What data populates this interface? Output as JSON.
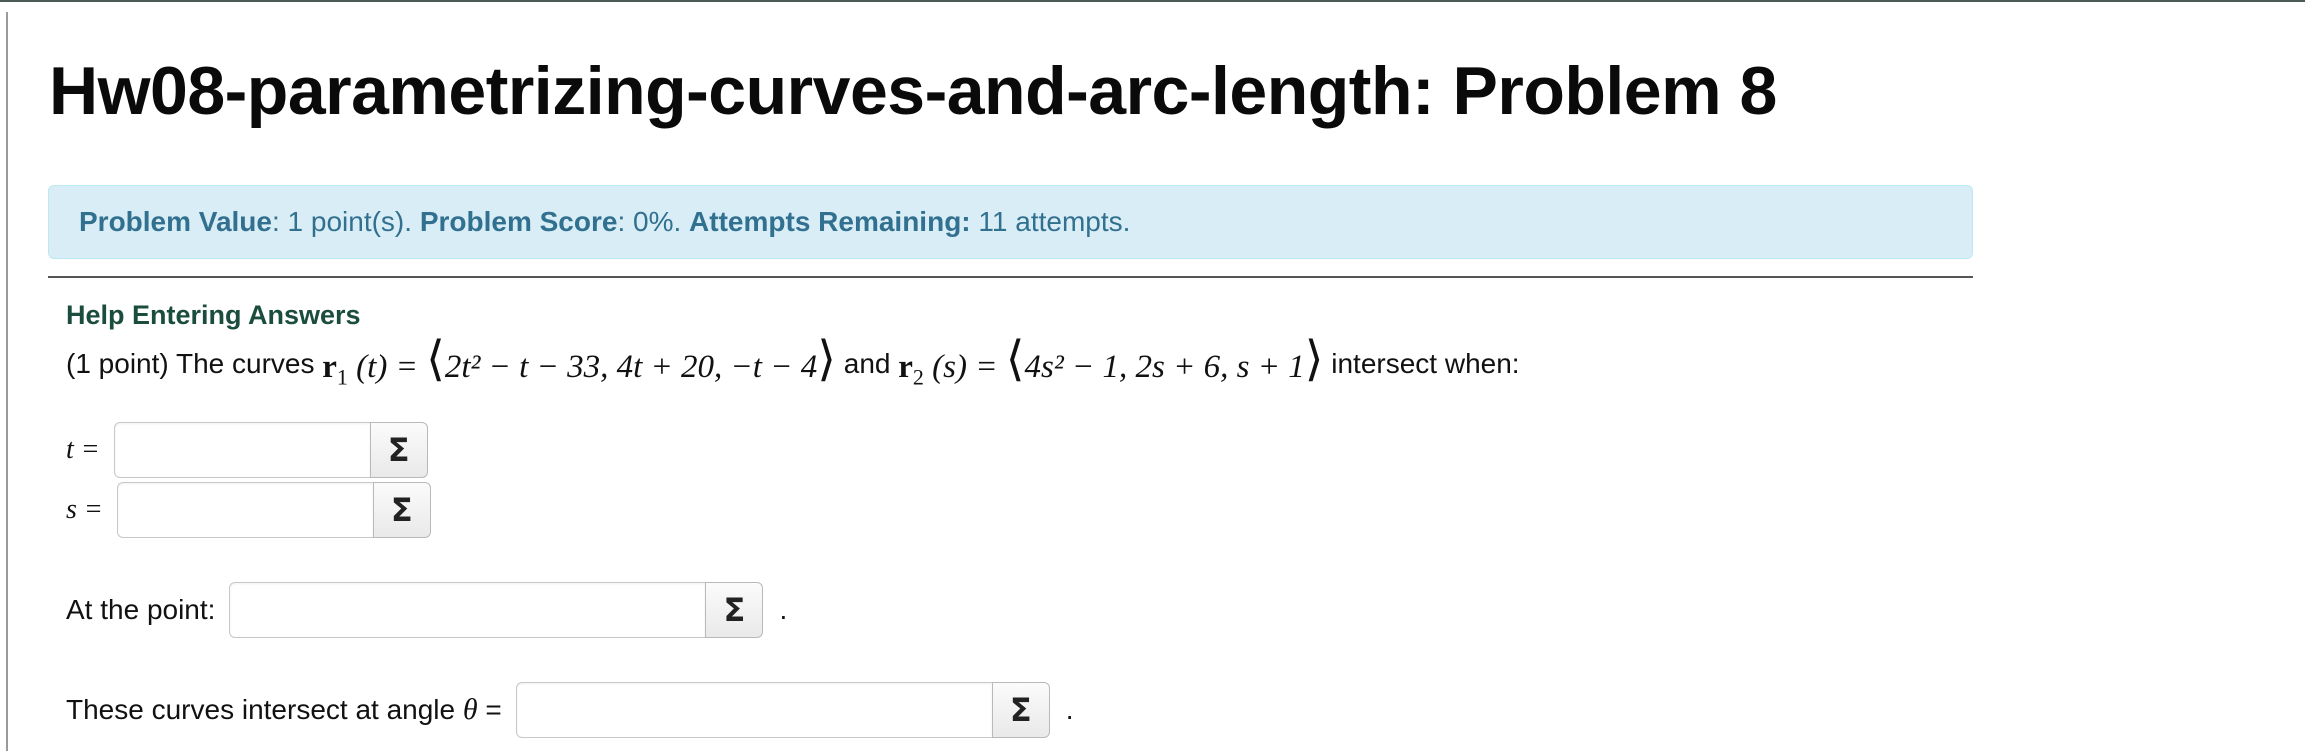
{
  "page": {
    "title": "Hw08-parametrizing-curves-and-arc-length: Problem 8"
  },
  "info": {
    "value_label": "Problem Value",
    "value_text": ": 1 point(s). ",
    "score_label": "Problem Score",
    "score_text": ": 0%. ",
    "attempts_label": "Attempts Remaining:",
    "attempts_text": " 11 attempts."
  },
  "help": {
    "label": "Help Entering Answers"
  },
  "problem": {
    "intro": "(1 point) The curves ",
    "and_text": " and ",
    "outro": " intersect when:",
    "r1_symbol": "r",
    "r1_sub": "1",
    "r1_arg": " (t) = ",
    "r1_components": "2t² − t − 33, 4t + 20, −t − 4",
    "r2_symbol": "r",
    "r2_sub": "2",
    "r2_arg": " (s) = ",
    "r2_components": "4s² − 1, 2s + 6, s + 1"
  },
  "answers": {
    "t_label": "t =",
    "s_label": "s =",
    "point_label": "At the point:",
    "angle_label_prefix": "These curves intersect at angle ",
    "angle_symbol": "θ",
    "angle_label_suffix": " =",
    "t_value": "",
    "s_value": "",
    "point_value": "",
    "angle_value": "",
    "sigma_glyph": "Σ",
    "period": "."
  }
}
